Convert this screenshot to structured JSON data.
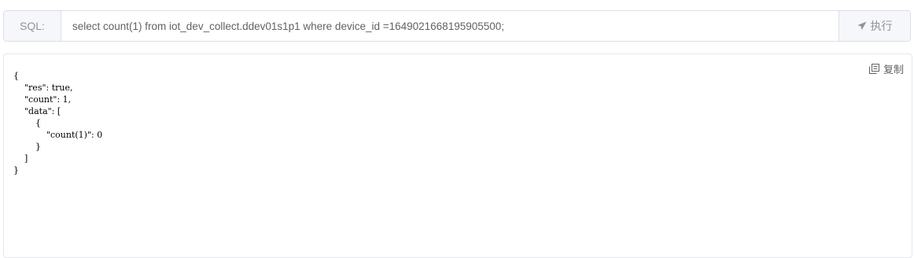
{
  "query": {
    "prefix_label": "SQL:",
    "sql_value": "select count(1) from iot_dev_collect.ddev01s1p1 where device_id =1649021668195905500;",
    "execute_label": "执行",
    "execute_icon": "paper-plane-icon"
  },
  "result": {
    "copy_label": "复制",
    "copy_icon": "copy-icon",
    "json_text": "{\n    \"res\": true,\n    \"count\": 1,\n    \"data\": [\n        {\n            \"count(1)\": 0\n        }\n    ]\n}"
  }
}
